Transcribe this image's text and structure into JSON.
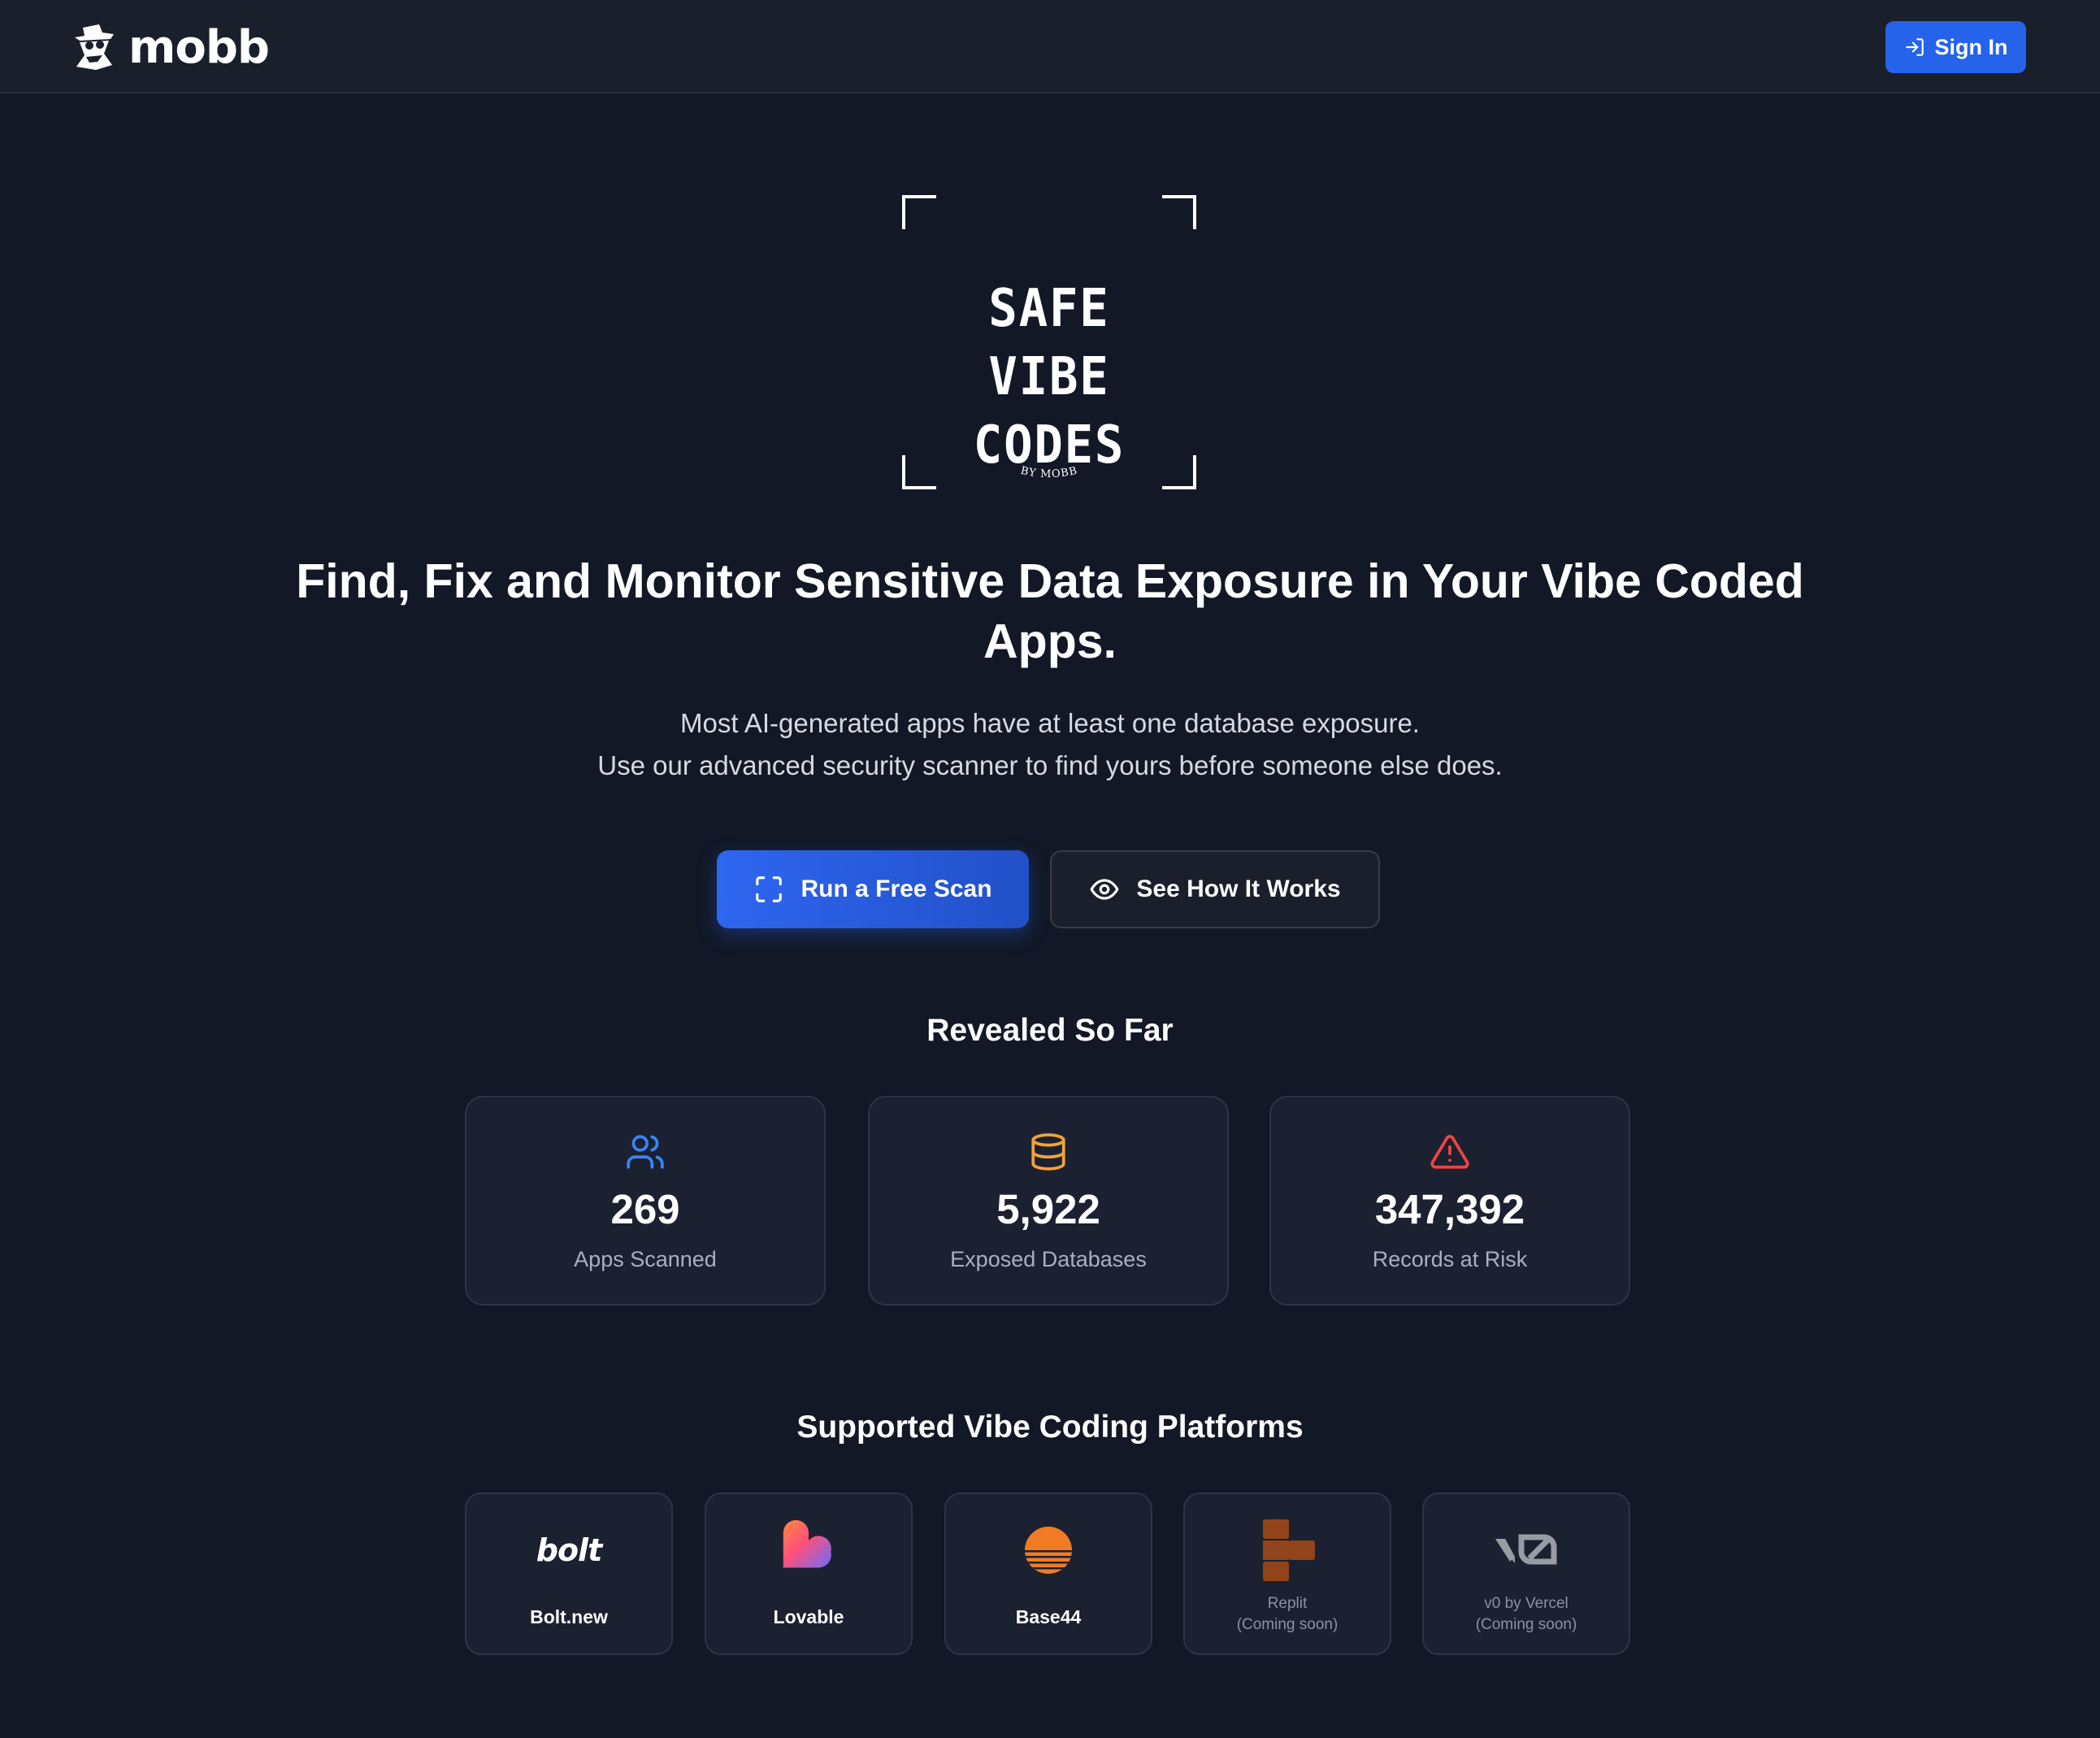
{
  "header": {
    "logo_text": "mobb",
    "logo_icon": "spy-hat-icon",
    "signin_label": "Sign In",
    "signin_icon": "sign-in-icon"
  },
  "hero": {
    "logo_title": "SAFE VIBE\nCODES",
    "logo_byline": "BY MOBB",
    "headline": "Find, Fix and Monitor Sensitive Data Exposure in Your Vibe Coded Apps.",
    "subline_1": "Most AI-generated apps have at least one database exposure.",
    "subline_2": "Use our advanced security scanner to find yours before someone else does.",
    "primary_cta": "Run a Free Scan",
    "primary_cta_icon": "scan-icon",
    "secondary_cta": "See How It Works",
    "secondary_cta_icon": "eye-icon"
  },
  "stats": {
    "title": "Revealed So Far",
    "items": [
      {
        "value": "269",
        "label": "Apps Scanned",
        "icon": "users-icon",
        "color": "#3b82f6"
      },
      {
        "value": "5,922",
        "label": "Exposed Databases",
        "icon": "database-icon",
        "color": "#f0a33c"
      },
      {
        "value": "347,392",
        "label": "Records at Risk",
        "icon": "alert-triangle-icon",
        "color": "#ef4444"
      }
    ]
  },
  "platforms": {
    "title": "Supported Vibe Coding Platforms",
    "items": [
      {
        "name": "Bolt.new",
        "logo_text": "bolt",
        "status": ""
      },
      {
        "name": "Lovable",
        "logo_text": "",
        "status": ""
      },
      {
        "name": "Base44",
        "logo_text": "",
        "status": ""
      },
      {
        "name": "Replit",
        "logo_text": "",
        "status": "(Coming soon)"
      },
      {
        "name": "v0 by Vercel",
        "logo_text": "",
        "status": "(Coming soon)"
      }
    ]
  },
  "colors": {
    "background": "#121826",
    "header": "#1a1f2c",
    "accent": "#2563eb",
    "card": "#1b2130"
  }
}
